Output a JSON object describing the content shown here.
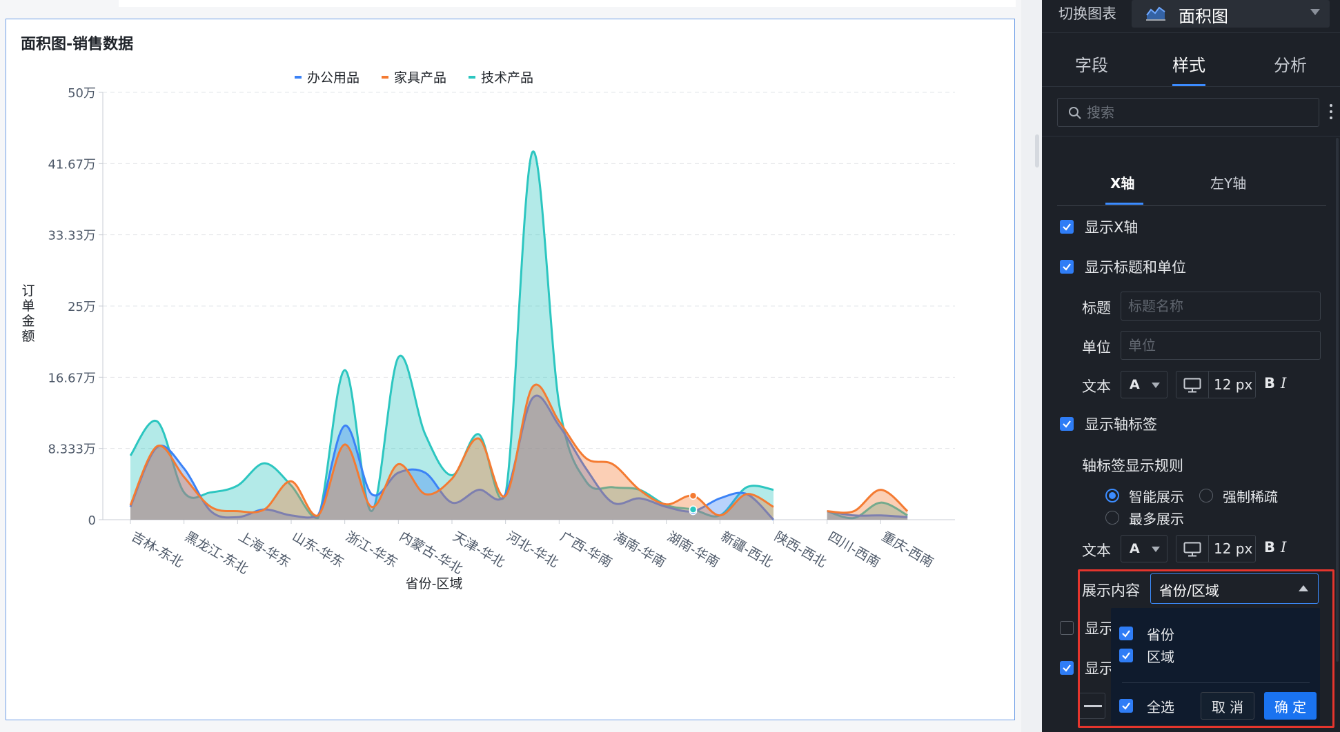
{
  "chart_card": {
    "title": "面积图-销售数据"
  },
  "chart_data": {
    "type": "area",
    "title": "面积图-销售数据",
    "xlabel": "省份-区域",
    "ylabel": "订单金额",
    "ylim": [
      0,
      500000
    ],
    "y_ticks": [
      "0",
      "8.333万",
      "16.67万",
      "25万",
      "33.33万",
      "41.67万",
      "50万"
    ],
    "grid": true,
    "smooth": true,
    "legend_position": "top-center",
    "x_tick_labels": [
      "吉林-东北",
      "黑龙江-东北",
      "上海-华东",
      "山东-华东",
      "浙江-华东",
      "内蒙古-华北",
      "天津-华北",
      "河北-华北",
      "广西-华南",
      "海南-华南",
      "湖南-华南",
      "新疆-西北",
      "陕西-西北",
      "四川-西南",
      "重庆-西南"
    ],
    "x": [
      0,
      0.5,
      1,
      1.5,
      2,
      2.5,
      3,
      3.5,
      4,
      4.5,
      5,
      5.5,
      6,
      6.5,
      7,
      7.5,
      8,
      8.5,
      9,
      9.5,
      10,
      10.5,
      11,
      11.5,
      12,
      12.5,
      13,
      13.5,
      14,
      14.5,
      15
    ],
    "series": [
      {
        "name": "办公用品",
        "color": "#3b82f6",
        "values": [
          15000,
          85000,
          60000,
          10000,
          3000,
          12000,
          5000,
          5000,
          110000,
          30000,
          55000,
          55000,
          20000,
          35000,
          30000,
          142000,
          110000,
          60000,
          20000,
          25000,
          15000,
          10000,
          25000,
          30000,
          0,
          null,
          10000,
          5000,
          5000,
          3000,
          null
        ]
      },
      {
        "name": "家具产品",
        "color": "#f47b32",
        "values": [
          17000,
          86000,
          50000,
          15000,
          10000,
          12000,
          45000,
          5000,
          88000,
          15000,
          65000,
          30000,
          48000,
          95000,
          28000,
          155000,
          115000,
          72000,
          65000,
          35000,
          18000,
          28000,
          5000,
          30000,
          15000,
          null,
          10000,
          10000,
          35000,
          10000,
          null
        ]
      },
      {
        "name": "技术产品",
        "color": "#2cc6c0",
        "values": [
          75000,
          115000,
          32000,
          32000,
          40000,
          66000,
          40000,
          2000,
          175000,
          10000,
          190000,
          100000,
          52000,
          100000,
          30000,
          430000,
          135000,
          45000,
          38000,
          35000,
          17000,
          12000,
          5000,
          38000,
          35000,
          null,
          10000,
          2000,
          20000,
          5000,
          null
        ]
      }
    ]
  },
  "panel": {
    "switch_label": "切换图表",
    "chart_type_value": "面积图",
    "tabs": [
      "字段",
      "样式",
      "分析"
    ],
    "search_placeholder": "搜索",
    "axis_tabs": [
      "X轴",
      "左Y轴"
    ],
    "show_x_axis": "显示X轴",
    "show_title_unit": "显示标题和单位",
    "title_label": "标题",
    "title_placeholder": "标题名称",
    "unit_label": "单位",
    "unit_placeholder": "单位",
    "text_label": "文本",
    "font_letter": "A",
    "font_size": "12 px",
    "bold": "B",
    "italic": "I",
    "show_axis_label": "显示轴标签",
    "label_rule": "轴标签显示规则",
    "radio_smart": "智能展示",
    "radio_sparse": "强制稀疏",
    "radio_max": "最多展示",
    "display_content_label": "展示内容",
    "display_content_value": "省份/区域",
    "hidden_row_1": "显示",
    "hidden_row_2": "显示",
    "dropdown": {
      "option_1": "省份",
      "option_2": "区域",
      "select_all": "全选",
      "cancel": "取 消",
      "confirm": "确 定"
    }
  },
  "colors": {
    "accent": "#3c8cff",
    "highlight": "#e5352d",
    "panel_bg": "#1d2128"
  }
}
